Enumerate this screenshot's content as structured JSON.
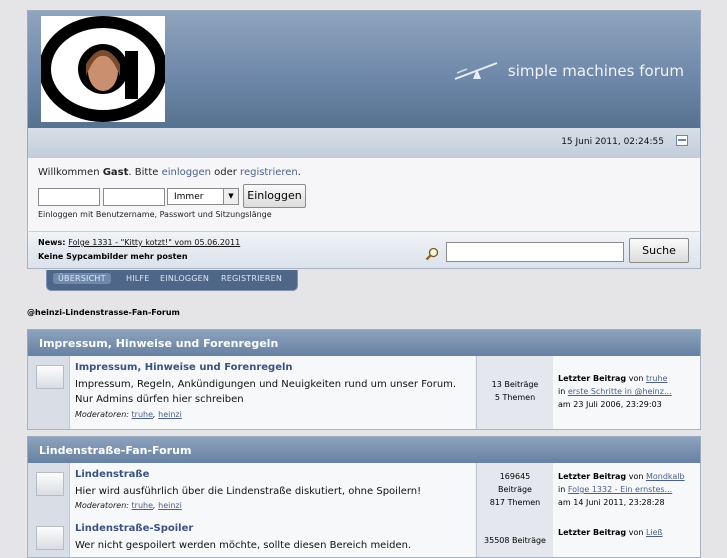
{
  "header": {
    "brand": "simple machines forum"
  },
  "upper": {
    "date": "15 Juni 2011, 02:24:55"
  },
  "userpanel": {
    "welcome_pre": "Willkommen ",
    "guest": "Gast",
    "welcome_mid": ". Bitte ",
    "login_link": "einloggen",
    "or": " oder ",
    "register_link": "registrieren",
    "dot": ".",
    "session_select": "Immer",
    "login_button": "Einloggen",
    "hint": "Einloggen mit Benutzername, Passwort und Sitzungslänge"
  },
  "news": {
    "label": "News",
    "link": "Folge 1331 - \"Kitty kotzt!\" vom 05.06.2011",
    "line2": "Keine Sypcambilder mehr posten",
    "search_button": "Suche"
  },
  "menu": {
    "items": [
      "ÜBERSICHT",
      "HILFE",
      "EINLOGGEN",
      "REGISTRIEREN"
    ]
  },
  "breadcrumb": "@heinzi-Lindenstrasse-Fan-Forum",
  "categories": [
    {
      "title": "Impressum, Hinweise und Forenregeln"
    },
    {
      "title": "Lindenstraße-Fan-Forum"
    }
  ],
  "boards": [
    {
      "name": "Impressum, Hinweise und Forenregeln",
      "desc": "Impressum, Regeln, Ankündigungen und Neuigkeiten rund um unser Forum. Nur Admins dürfen hier schreiben",
      "mod_label": "Moderatoren:",
      "mod1": "truhe",
      "mod2": "heinzi",
      "stat1": "13 Beiträge",
      "stat2": "5 Themen",
      "stat3": "",
      "last_label": "Letzter Beitrag",
      "last_by": "von",
      "last_user": "truhe",
      "last_in": "in",
      "last_topic": "erste Schritte in @heinz...",
      "last_date": "am 23 Juli 2006, 23:29:03"
    },
    {
      "name": "Lindenstraße",
      "desc": "Hier wird ausführlich über die Lindenstraße diskutiert, ohne Spoilern!",
      "mod_label": "Moderatoren:",
      "mod1": "truhe",
      "mod2": "heinzi",
      "stat1": "169645",
      "stat2": "Beiträge",
      "stat3": "817 Themen",
      "last_label": "Letzter Beitrag",
      "last_by": "von",
      "last_user": "Mondkalb",
      "last_in": "in",
      "last_topic": "Folge 1332 - Ein ernstes...",
      "last_date": "am 14 Juni 2011, 23:28:28"
    },
    {
      "name": "Lindenstraße-Spoiler",
      "desc": "Wer nicht gespoilert werden möchte, sollte diesen Bereich meiden.",
      "stat1": "35508 Beiträge",
      "last_label": "Letzter Beitrag",
      "last_by": "von",
      "last_user": "Ließ"
    }
  ]
}
